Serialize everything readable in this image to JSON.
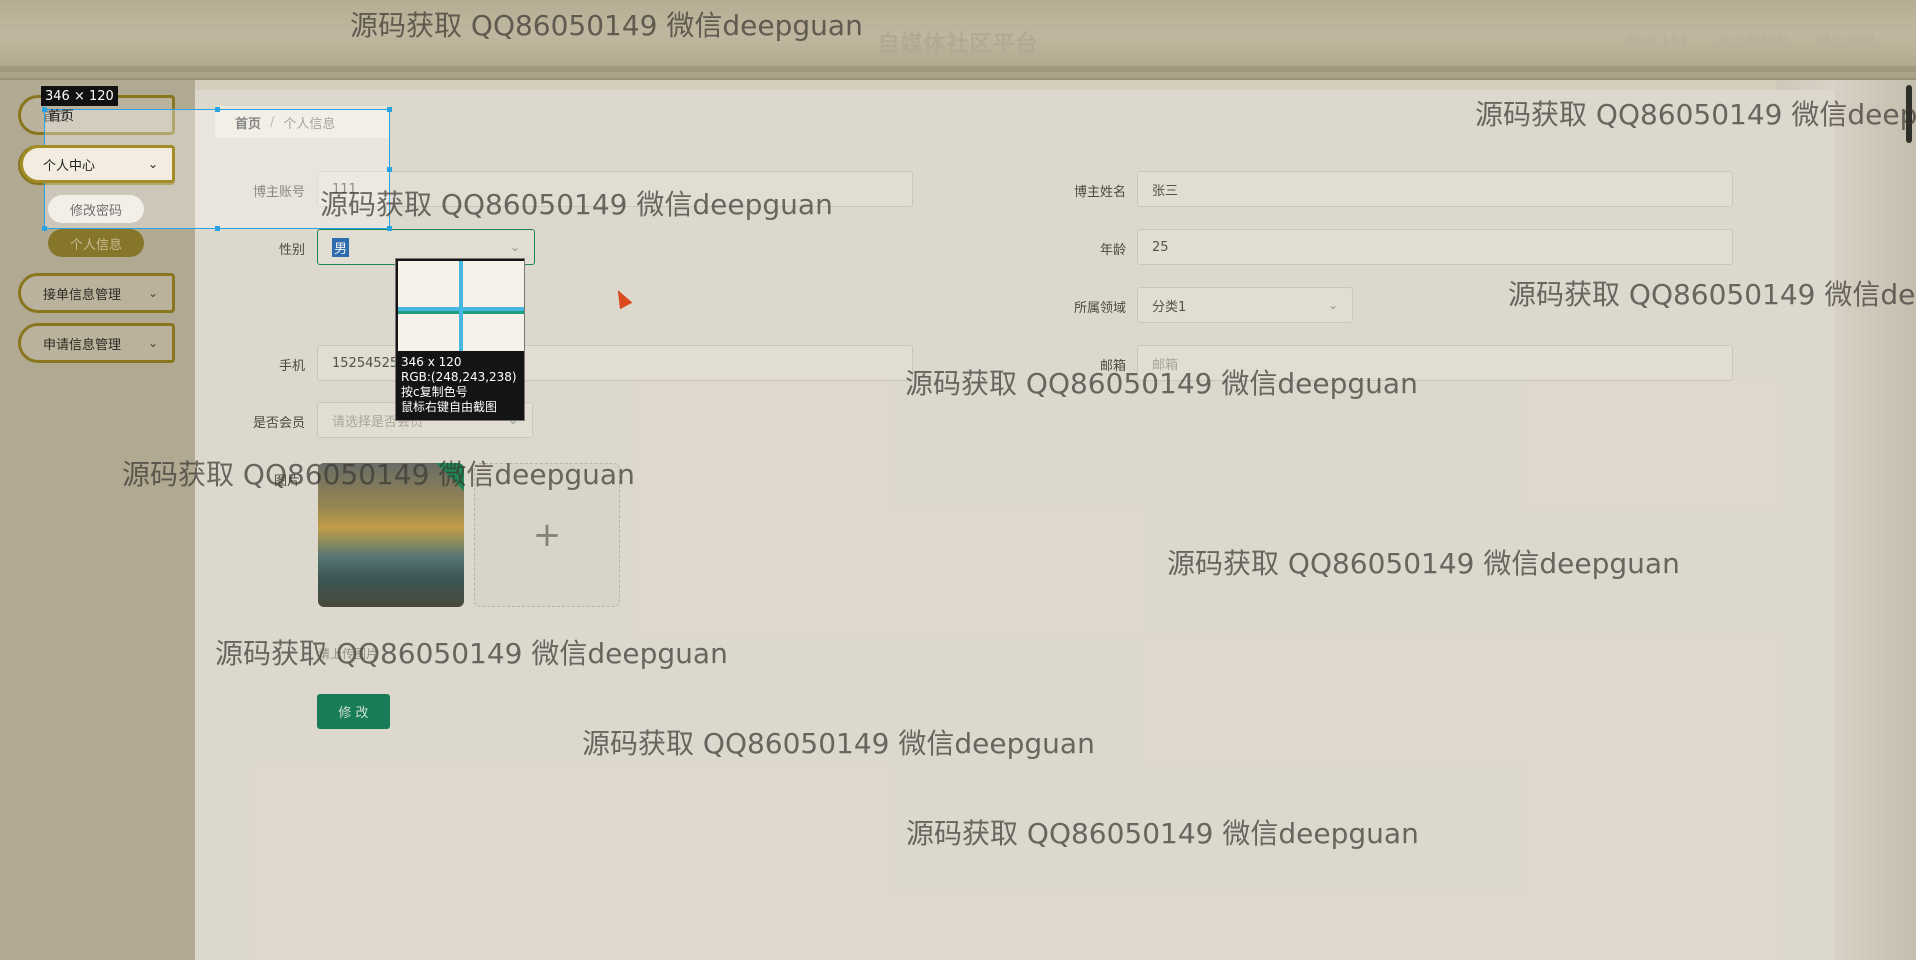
{
  "header": {
    "title": "自媒体社区平台",
    "links": [
      "用户 111",
      "退出到前台",
      "退出登录"
    ]
  },
  "sidebar": {
    "home": "首页",
    "personal_center": "个人中心",
    "change_password": "修改密码",
    "personal_info": "个人信息",
    "orders_mgmt": "接单信息管理",
    "apply_mgmt": "申请信息管理"
  },
  "breadcrumb": {
    "home": "首页",
    "sep": "/",
    "current": "个人信息"
  },
  "form": {
    "account_label": "博主账号",
    "account_value": "111",
    "name_label": "博主姓名",
    "name_value": "张三",
    "gender_label": "性别",
    "gender_value": "男",
    "age_label": "年龄",
    "age_value": "25",
    "domain_label": "所属领域",
    "domain_value": "分类1",
    "phone_label": "手机",
    "phone_value": "15254525",
    "email_label": "邮箱",
    "email_placeholder": "邮箱",
    "member_label": "是否会员",
    "member_placeholder": "请选择是否会员",
    "image_label": "图片",
    "upload_plus": "+",
    "upload_hint": "请上传图片",
    "submit_label": "修 改"
  },
  "capture_tool": {
    "size": "346 × 120",
    "mag_size": "346 x 120",
    "mag_rgb": "RGB:(248,243,238)",
    "mag_copy": "按c复制色号",
    "mag_free": "鼠标右键自由截图"
  },
  "watermark": "源码获取 QQ86050149 微信deepguan",
  "colors": {
    "accent": "#16805a",
    "sidebar_border": "#8d7b1e",
    "selection": "#2ba3e3"
  }
}
